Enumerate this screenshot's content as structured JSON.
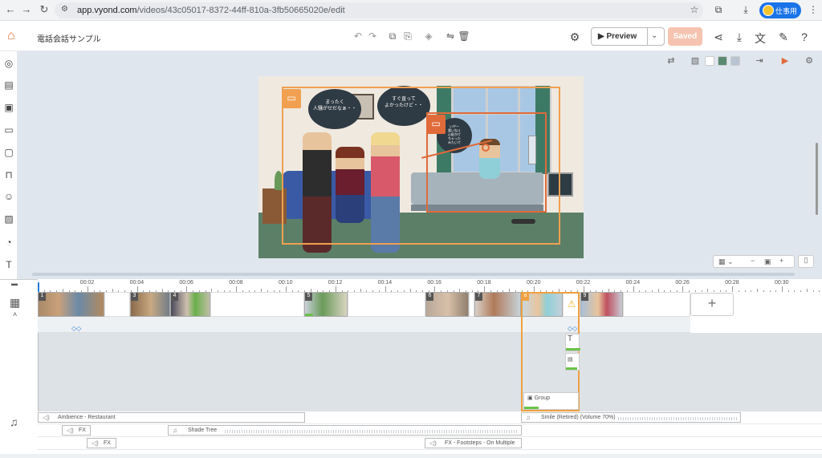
{
  "browser": {
    "url_host": "app.vyond.com",
    "url_path": "/videos/43c05017-8372-44ff-810a-3fb50665020e/edit",
    "profile_label": "仕事用"
  },
  "header": {
    "video_title": "電話会話サンプル",
    "preview_label": "Preview",
    "saved_label": "Saved"
  },
  "stage": {
    "bubble1": "まったく\n人騒がせだなぁ・・",
    "bubble2": "すぐ直って\nよかったけど・・",
    "bubble3": "いやー\n悪いねぇ\n心配かけ\nちゃった\nみたいで"
  },
  "ruler": {
    "labels": [
      "00:02",
      "00:04",
      "00:06",
      "00:08",
      "00:10",
      "00:12",
      "00:14",
      "00:16",
      "00:18",
      "00:20",
      "00:22",
      "00:24",
      "00:26",
      "00:28",
      "00:30"
    ]
  },
  "scenes": [
    "1",
    "3",
    "4",
    "5",
    "6",
    "7",
    "8",
    "9"
  ],
  "group": {
    "label": "Group"
  },
  "audio_tracks": {
    "ambience": "Ambience - Restaurant",
    "smile": "Smile (Retired) (Volume 70%)",
    "fx1": "FX",
    "shade": "Shade Tree",
    "fx2": "FX",
    "footsteps": "FX - Footsteps - On Multiple"
  },
  "colors": {
    "accent": "#e8703a",
    "saved_bg": "#f5c4b0",
    "selection": "#f0a040",
    "frame_red": "#e06a3a",
    "keyframe": "#2b7bd8",
    "progress": "#6ac34a"
  },
  "icons": {
    "home": "home-icon",
    "undo": "undo-icon",
    "redo": "redo-icon",
    "share": "share-icon",
    "download": "download-icon",
    "help": "help-icon"
  }
}
